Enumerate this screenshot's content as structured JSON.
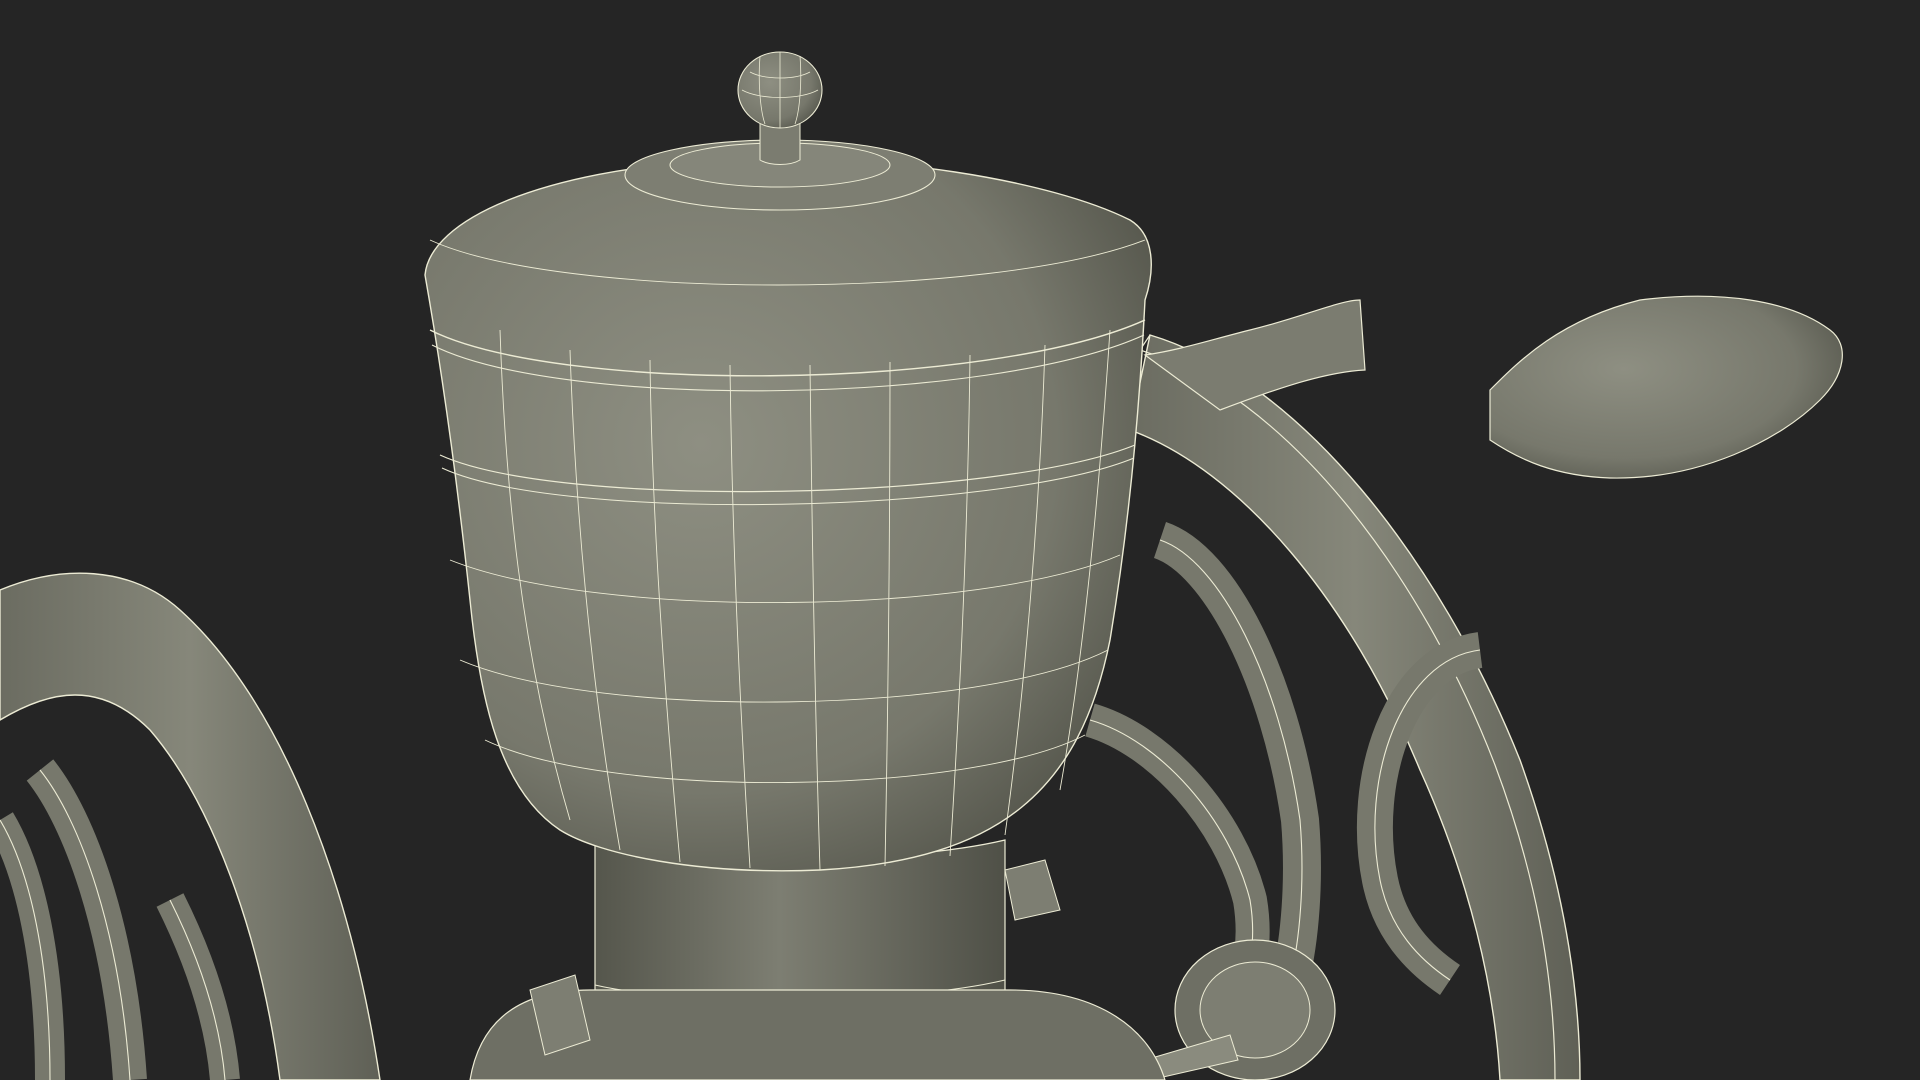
{
  "scene": {
    "subject": "coffee-grinder-wireframe-render",
    "background_color": "#252525",
    "surface_color": "#7b7c70",
    "surface_shadow_color": "#55564c",
    "surface_light_color": "#8e8f82",
    "wire_color": "#ecebd4"
  }
}
